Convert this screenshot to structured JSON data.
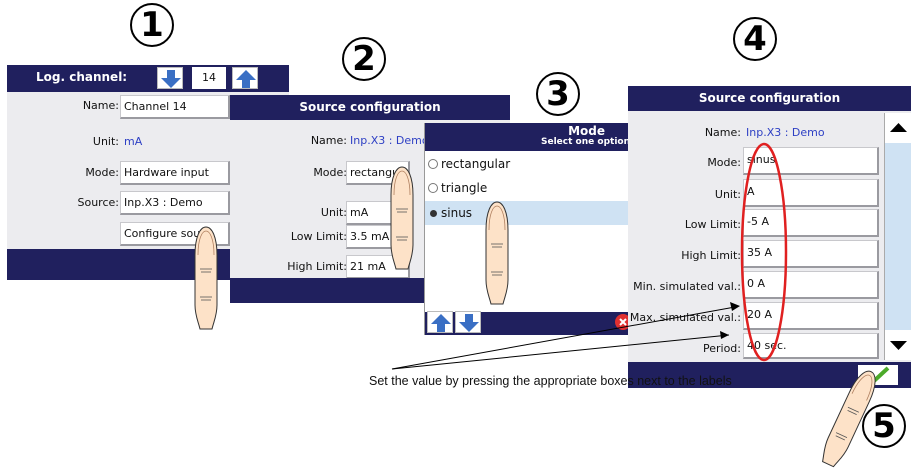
{
  "steps": [
    "1",
    "2",
    "3",
    "4",
    "5"
  ],
  "colors": {
    "header": "#20205e",
    "panel": "#ececef",
    "accent_blue": "#2d3fc4",
    "oval": "#e02020",
    "check": "#4caa2a",
    "close": "#e03030"
  },
  "panel1": {
    "header_label": "Log. channel:",
    "channel_value": "14",
    "rows": [
      {
        "label": "Name:",
        "value": "Channel 14"
      },
      {
        "label": "Unit:",
        "value": "mA"
      },
      {
        "label": "Mode:",
        "value": "Hardware input"
      },
      {
        "label": "Source:",
        "value": "Inp.X3 : Demo"
      }
    ],
    "button": "Configure sour"
  },
  "panel2": {
    "title": "Source configuration",
    "rows": [
      {
        "label": "Name:",
        "value": "Inp.X3 : Demo"
      },
      {
        "label": "Mode:",
        "value": "rectangul"
      },
      {
        "label": "Unit:",
        "value": "mA"
      },
      {
        "label": "Low Limit:",
        "value": "3.5 mA"
      },
      {
        "label": "High Limit:",
        "value": "21 mA"
      }
    ]
  },
  "panel3": {
    "title": "Mode",
    "subtitle": "Select one option",
    "options": [
      "rectangular",
      "triangle",
      "sinus"
    ],
    "selected": "sinus"
  },
  "panel4": {
    "title": "Source configuration",
    "rows": [
      {
        "label": "Name:",
        "value": "Inp.X3 : Demo"
      },
      {
        "label": "Mode:",
        "value": "sinus"
      },
      {
        "label": "Unit:",
        "value": "A"
      },
      {
        "label": "Low Limit:",
        "value": "-5 A"
      },
      {
        "label": "High Limit:",
        "value": "35 A"
      },
      {
        "label": "Min. simulated val.:",
        "value": "0 A"
      },
      {
        "label": "Max. simulated val.:",
        "value": "20 A"
      },
      {
        "label": "Period:",
        "value": "40 sec."
      }
    ]
  },
  "note": "Set the value by pressing the appropriate boxes next to the labels"
}
